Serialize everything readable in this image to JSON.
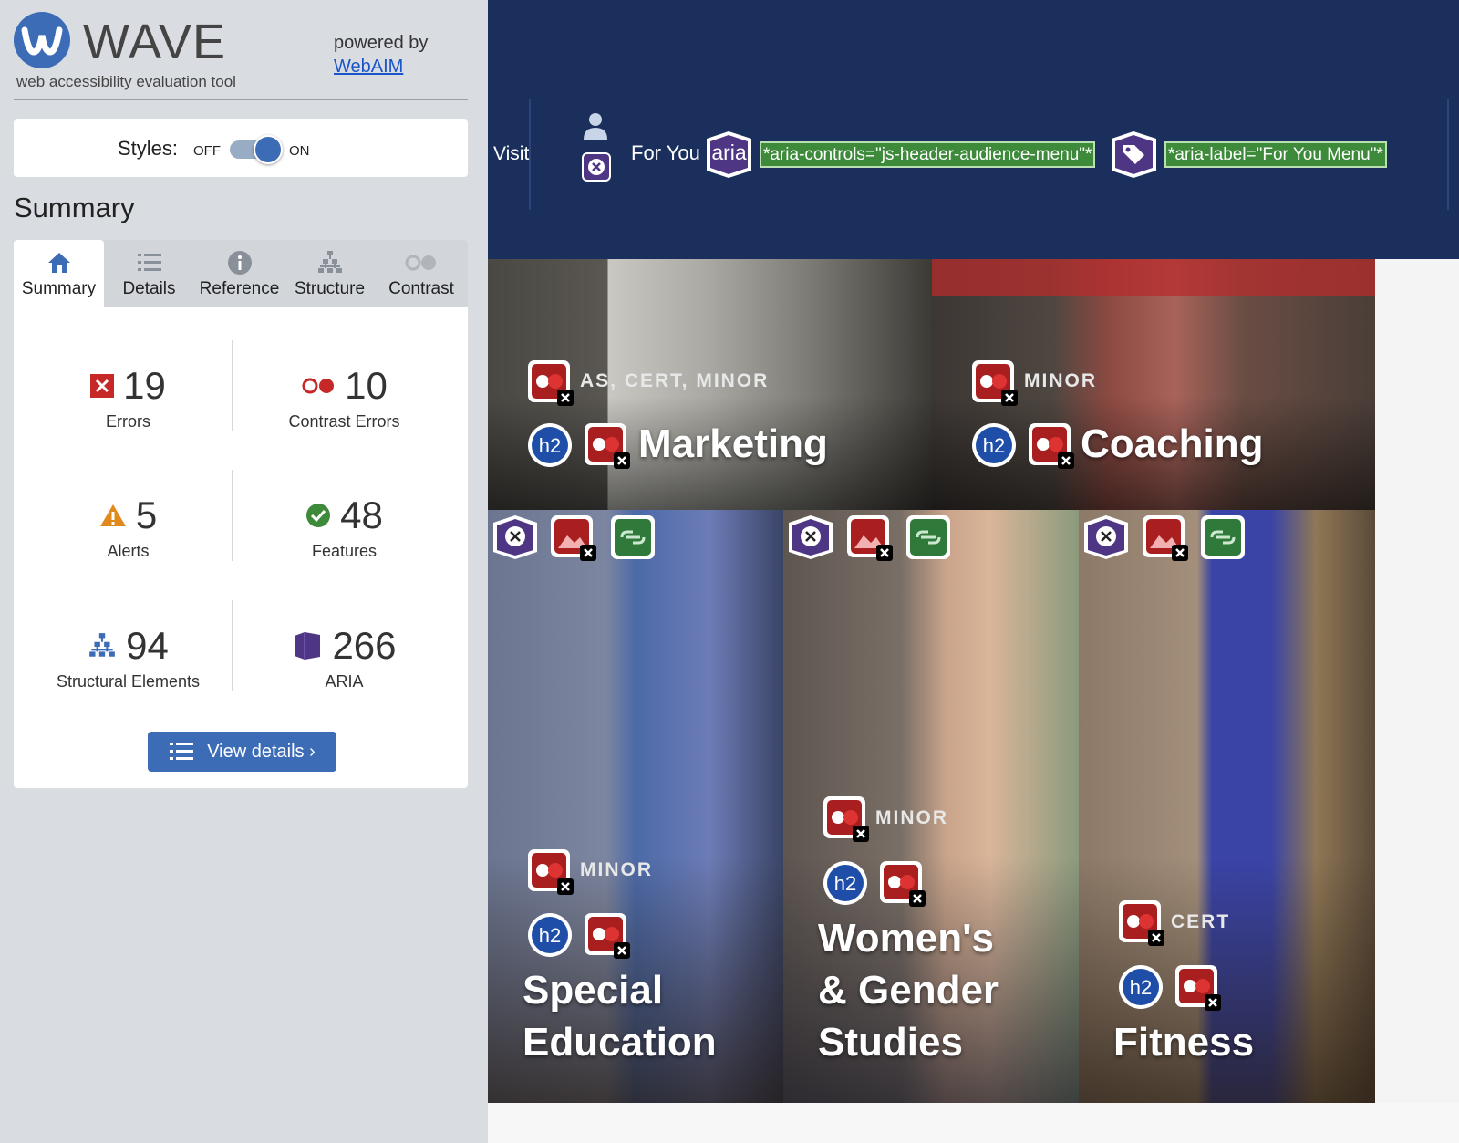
{
  "logo": {
    "word": "WAVE",
    "subtitle": "web accessibility evaluation tool",
    "powered_by": "powered by",
    "powered_link": "WebAIM"
  },
  "styles": {
    "label": "Styles:",
    "off": "OFF",
    "on": "ON"
  },
  "summary_heading": "Summary",
  "tabs": [
    {
      "label": "Summary",
      "icon": "home-icon"
    },
    {
      "label": "Details",
      "icon": "list-icon"
    },
    {
      "label": "Reference",
      "icon": "info-icon"
    },
    {
      "label": "Structure",
      "icon": "structure-icon"
    },
    {
      "label": "Contrast",
      "icon": "contrast-icon"
    }
  ],
  "stats": {
    "errors": {
      "value": "19",
      "label": "Errors",
      "icon": "error-icon"
    },
    "contrast": {
      "value": "10",
      "label": "Contrast Errors",
      "icon": "contrast-icon"
    },
    "alerts": {
      "value": "5",
      "label": "Alerts",
      "icon": "alert-icon"
    },
    "features": {
      "value": "48",
      "label": "Features",
      "icon": "feature-icon"
    },
    "structural": {
      "value": "94",
      "label": "Structural Elements",
      "icon": "structure-icon"
    },
    "aria": {
      "value": "266",
      "label": "ARIA",
      "icon": "aria-icon"
    }
  },
  "view_details": "View details ›",
  "preview": {
    "visit": "Visit",
    "for_you": "For You",
    "aria_badge": "aria",
    "aria_controls": "*aria-controls=\"js-header-audience-menu\"*",
    "aria_label": "*aria-label=\"For You Menu\"*",
    "h2": "h2",
    "tiles": [
      {
        "tag": "AS, CERT, MINOR",
        "title": "Marketing"
      },
      {
        "tag": "MINOR",
        "title": "Coaching"
      },
      {
        "tag": "MINOR",
        "title_lines": [
          "Special",
          "Education"
        ]
      },
      {
        "tag": "MINOR",
        "title_lines": [
          "Women's",
          "& Gender",
          "Studies"
        ]
      },
      {
        "tag": "CERT",
        "title": "Fitness"
      }
    ]
  },
  "colors": {
    "wave_blue": "#3d6cb6",
    "nav_navy": "#1a2f5c",
    "error_red": "#c62828",
    "aria_purple": "#4f3685",
    "feature_green": "#3d8a3a"
  }
}
